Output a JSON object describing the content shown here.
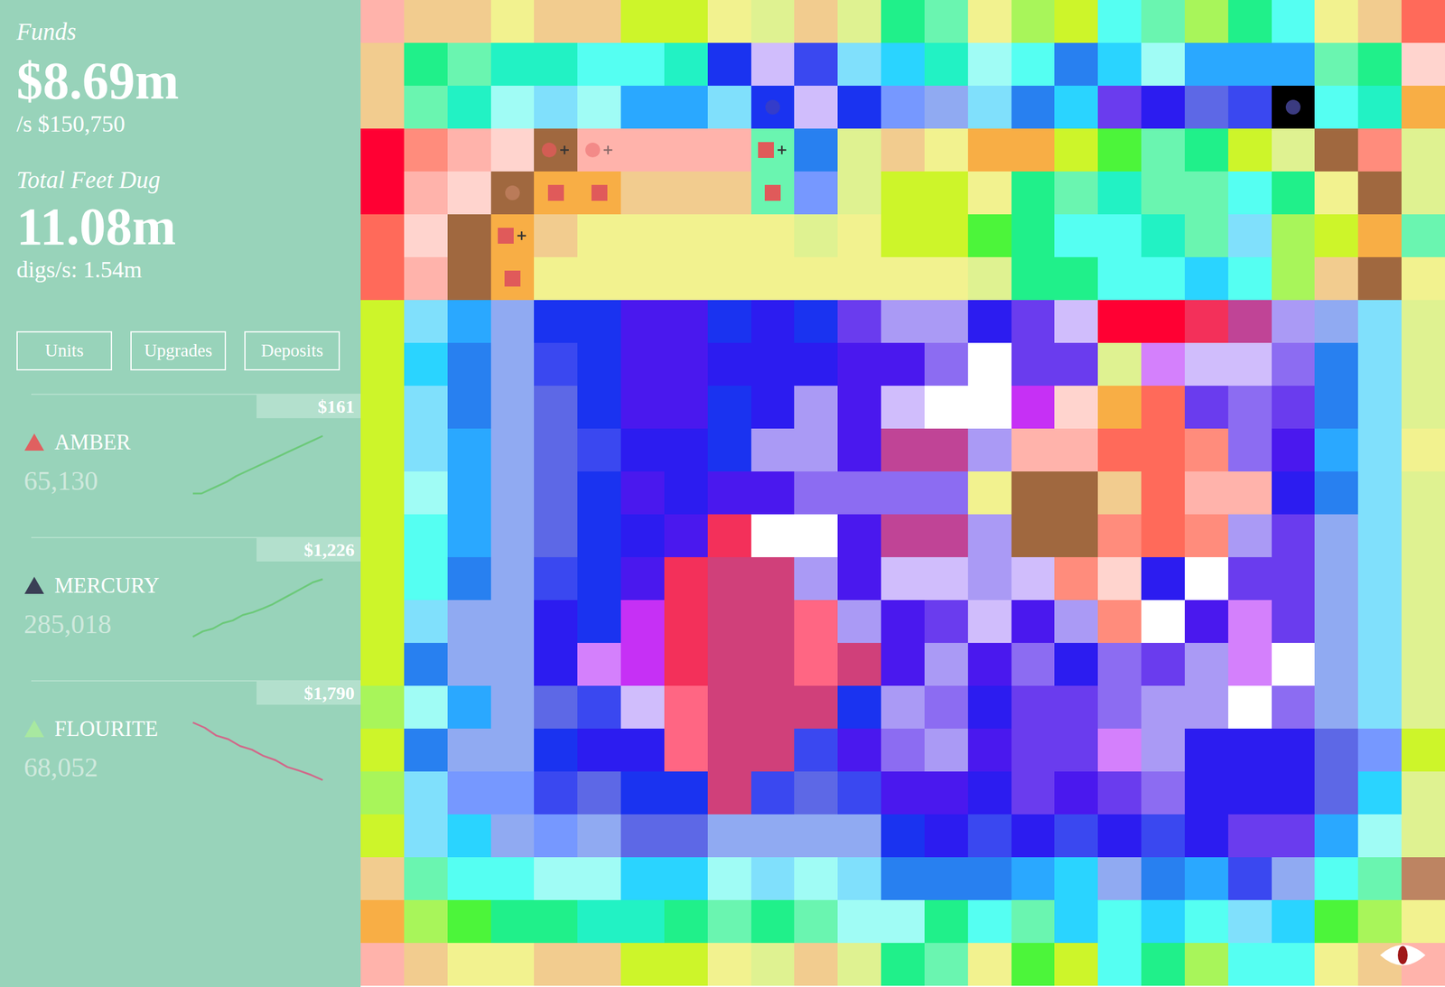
{
  "funds": {
    "label": "Funds",
    "value": "$8.69m",
    "rate": "/s $150,750"
  },
  "dug": {
    "label": "Total Feet Dug",
    "value": "11.08m",
    "rate": "digs/s: 1.54m"
  },
  "buttons": [
    "Units",
    "Upgrades",
    "Deposits"
  ],
  "resources": [
    {
      "name": "AMBER",
      "count": "65,130",
      "price": "$161",
      "color": "#e06060",
      "line_color": "#6cc97a",
      "series": [
        118,
        118,
        121,
        124,
        127,
        131,
        134,
        137,
        140,
        143,
        146,
        149,
        152,
        155,
        158,
        161
      ]
    },
    {
      "name": "MERCURY",
      "count": "285,018",
      "price": "$1,226",
      "color": "#3a3f55",
      "line_color": "#6cc97a",
      "series": [
        1120,
        1130,
        1135,
        1145,
        1150,
        1160,
        1165,
        1172,
        1180,
        1190,
        1200,
        1210,
        1220,
        1226
      ]
    },
    {
      "name": "FLOURITE",
      "count": "68,052",
      "price": "$1,790",
      "color": "#a8e8a0",
      "line_color": "#d06a8a",
      "series": [
        1900,
        1890,
        1875,
        1868,
        1855,
        1848,
        1836,
        1828,
        1815,
        1808,
        1800,
        1790
      ]
    }
  ],
  "map": {
    "palette": {
      "A": "#f2cc8f",
      "B": "#f2f28f",
      "C": "#cdf52a",
      "D": "#dff291",
      "E": "#20f08a",
      "F": "#6af5b0",
      "G": "#22f2c4",
      "H": "#55fff2",
      "I": "#a0fcf5",
      "J": "#80e0fc",
      "K": "#2ad4ff",
      "L": "#2aa8ff",
      "M": "#2880f0",
      "N": "#1a33f0",
      "O": "#3a48f0",
      "P": "#5d68e6",
      "Q": "#90aaf2",
      "R": "#7698ff",
      "S": "#2c1cf0",
      "T": "#4a18ee",
      "U": "#6a3cee",
      "V": "#8c6cf2",
      "W": "#aa9af5",
      "X": "#d0bdfc",
      "Y": "#d480fc",
      "Z": "#c630f5",
      "a": "#ffb3ab",
      "b": "#ffd4ce",
      "c": "#ff8c7c",
      "d": "#ff6a5a",
      "e": "#ff0033",
      "f": "#f3305a",
      "g": "#d0407a",
      "h": "#c04496",
      "i": "#ff6683",
      "j": "#a0683f",
      "k": "#f8ae45",
      "l": "#a8f55a",
      "m": "#4cf53a",
      "n": "#000000",
      "o": "#bd8462"
    },
    "rows": [
      "aAABAACCBDADEFBlCHFlEHBAd",
      "AEFGGHHGNXOJKGIHMKILLLFEb",
      "AFGIJILLJNXNRQJMKUSPOnHGk",
      "ecabjaaaaFMDABkkCmFECDjcD",
      "eabjkkAAAFRDCCBEFGFFHEBjD",
      "dbjkABBBBBDBCCmEHHGFJlCkF",
      "dajkBBBBBBBBBBDEEHHKHlAjB",
      "CJLQNNTTNSNUWWSUXeefhWQJD",
      "CKMQONTTSSSTTVrUUDYXXVMJD",
      "CJMQPNTTNSWTXrrZbkdUVUMJD",
      "CJLQPOSSNWWThhWaaddcVTLJB",
      "CILQPNTSTTVVVVBjjAdaaSMJD",
      "CHLQPNSTfrrThhWjjcdcWUQJD",
      "CHMQONTfggWTXXWXcbSrUUQJD",
      "CJQQSNZfggiWTUXTWcrTYUQJD",
      "CMQQSYZfggigTWTVSVUWYrQJD",
      "lILQPOXigggNWVSUUVWWrVQJD",
      "CMQQNSSiggOTVWTUUYWSSSPRC",
      "lJRROPNNgOPOTTSUTUVSSSPKD",
      "CJKQRQPPQQQQNSOSOSOSUULID",
      "AFHHIIKKIJIJMMMLKQMLOQHFo",
      "klmEEGGEFEFIIEHFKHKHJKmlB",
      "aABBAACCBDADEFBmCHElHHBAa"
    ],
    "units": [
      {
        "row": 2,
        "col": 9,
        "kind": "dot",
        "color": "#3b3fc0"
      },
      {
        "row": 2,
        "col": 21,
        "kind": "dot",
        "color": "#4a4aa0"
      },
      {
        "row": 3,
        "col": 4,
        "kind": "dot",
        "color": "#e05a5a"
      },
      {
        "row": 3,
        "col": 4,
        "kind": "plus",
        "color": "#333333"
      },
      {
        "row": 3,
        "col": 5,
        "kind": "dot",
        "color": "#f08080"
      },
      {
        "row": 3,
        "col": 5,
        "kind": "plus",
        "color": "#8a6a6a"
      },
      {
        "row": 3,
        "col": 9,
        "kind": "square",
        "color": "#e05a5a"
      },
      {
        "row": 3,
        "col": 9,
        "kind": "plus",
        "color": "#333333"
      },
      {
        "row": 4,
        "col": 3,
        "kind": "dot",
        "color": "#c08060"
      },
      {
        "row": 4,
        "col": 4,
        "kind": "square",
        "color": "#e05a5a"
      },
      {
        "row": 4,
        "col": 5,
        "kind": "square",
        "color": "#e05a5a"
      },
      {
        "row": 4,
        "col": 9,
        "kind": "square",
        "color": "#e05a5a"
      },
      {
        "row": 5,
        "col": 3,
        "kind": "square",
        "color": "#e05a5a"
      },
      {
        "row": 5,
        "col": 3,
        "kind": "plus",
        "color": "#333333"
      },
      {
        "row": 6,
        "col": 3,
        "kind": "square",
        "color": "#e05a5a"
      }
    ]
  }
}
